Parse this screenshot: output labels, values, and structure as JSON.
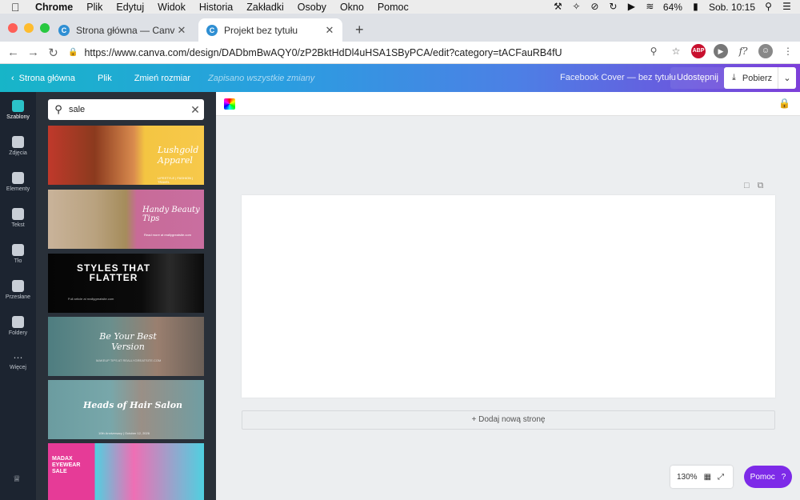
{
  "menubar": {
    "app": "Chrome",
    "items": [
      "Plik",
      "Edytuj",
      "Widok",
      "Historia",
      "Zakładki",
      "Osoby",
      "Okno",
      "Pomoc"
    ],
    "battery": "64%",
    "clock": "Sob. 10:15"
  },
  "browser": {
    "tabs": [
      {
        "title": "Strona główna — Canva"
      },
      {
        "title": "Projekt bez tytułu"
      }
    ],
    "url": "https://www.canva.com/design/DADbmBwAQY0/zP2BktHdDl4uHSA1SByPCA/edit?category=tACFauRB4fU",
    "ext_abp": "ABP",
    "ext_f": "f?"
  },
  "canvabar": {
    "home": "Strona główna",
    "file": "Plik",
    "resize": "Zmień rozmiar",
    "saved": "Zapisano wszystkie zmiany",
    "design_title": "Facebook Cover — bez tytułu",
    "share": "Udostępnij",
    "download": "Pobierz"
  },
  "leftnav": {
    "items": [
      "Szablony",
      "Zdjęcia",
      "Elementy",
      "Tekst",
      "Tło",
      "Przesłane",
      "Foldery",
      "Więcej"
    ]
  },
  "search": {
    "value": "sale"
  },
  "templates": [
    {
      "title": "Lushgold Apparel",
      "sub": "LIFESTYLE | FASHION | TRAVEL"
    },
    {
      "title": "Handy Beauty Tips",
      "sub": "Read more at reallygreatsite.com"
    },
    {
      "title": "STYLES THAT FLATTER",
      "sub": "Full article at reallygreatsite.com"
    },
    {
      "title": "Be Your Best Version",
      "sub": "MAKEUP TIPS AT REALLYGREATSITE.COM"
    },
    {
      "title": "Heads of Hair Salon",
      "sub": "10th Anniversary | October 12, 2026"
    },
    {
      "title": "MADAX EYEWEAR SALE",
      "sub": ""
    }
  ],
  "editor": {
    "add_page": "+ Dodaj nową stronę",
    "zoom": "130%",
    "help": "Pomoc",
    "help_icon": "?"
  },
  "colors": {
    "accent": "#7d2ae8",
    "active_nav": "#2bc2c8"
  }
}
